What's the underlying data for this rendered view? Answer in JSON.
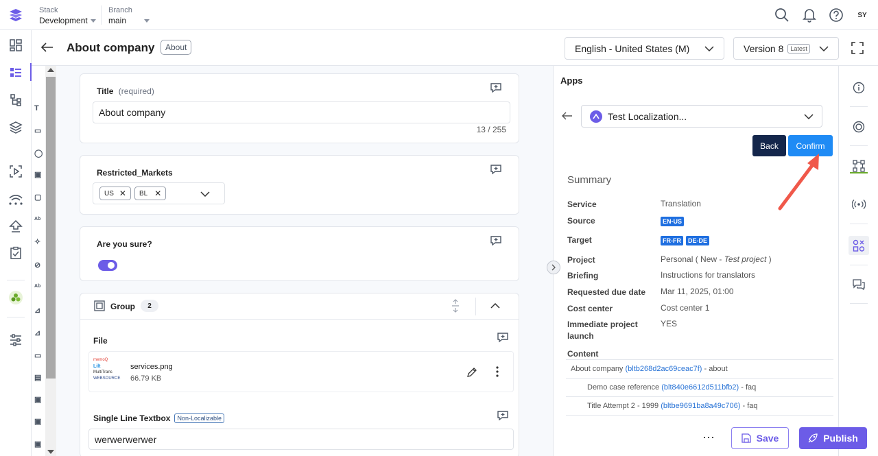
{
  "topbar": {
    "stack_label": "Stack",
    "stack_value": "Development",
    "branch_label": "Branch",
    "branch_value": "main",
    "avatar": "SY"
  },
  "header": {
    "title": "About company",
    "content_type_pill": "About",
    "locale": "English - United States (M)",
    "version": "Version 8",
    "version_badge": "Latest"
  },
  "left_rail_icons": [
    "dashboard-icon",
    "entries-icon",
    "content-models-icon",
    "assets-icon",
    "releases-icon",
    "workflows-icon",
    "deploy-icon",
    "tasks-icon",
    "apps-icon",
    "settings-icon"
  ],
  "field_strip": [
    "T",
    "▭",
    "◯",
    "▣",
    "▢",
    "Ab",
    "✧",
    "⊘",
    "Ab",
    "⊿",
    "⊿",
    "▭",
    "▤",
    "▣",
    "▣",
    "▣"
  ],
  "fields": {
    "title": {
      "label": "Title",
      "hint": "(required)",
      "value": "About company",
      "count": "13 / 255"
    },
    "restricted": {
      "label": "Restricted_Markets",
      "tags": [
        "US",
        "BL"
      ]
    },
    "sure": {
      "label": "Are you sure?",
      "toggle_on": true
    },
    "group": {
      "label": "Group",
      "count": "2",
      "file_label": "File",
      "file_name": "services.png",
      "file_size": "66.79 KB",
      "thumb_lines": [
        "memoQ",
        "Lilt",
        "MultiTrans",
        "WEBSOURCE"
      ],
      "textbox_label": "Single Line Textbox",
      "textbox_badge": "Non-Localizable",
      "textbox_value": "werwerwerwer"
    }
  },
  "apps_panel": {
    "title": "Apps",
    "app_select": "Test Localization...",
    "back_button": "Back",
    "confirm_button": "Confirm",
    "summary_title": "Summary",
    "rows": {
      "service": {
        "key": "Service",
        "value": "Translation"
      },
      "source": {
        "key": "Source",
        "tags": [
          "EN-US"
        ]
      },
      "target": {
        "key": "Target",
        "tags": [
          "FR-FR",
          "DE-DE"
        ]
      },
      "project": {
        "key": "Project",
        "value_a": "Personal ( New - ",
        "value_b": "Test project",
        "value_c": " )"
      },
      "briefing": {
        "key": "Briefing",
        "value": "Instructions for translators"
      },
      "due": {
        "key": "Requested due date",
        "value": "Mar 11, 2025, 01:00"
      },
      "cost": {
        "key": "Cost center",
        "value": "Cost center 1"
      },
      "launch": {
        "key": "Immediate project launch",
        "value": "YES"
      }
    },
    "content_label": "Content",
    "content": [
      {
        "title": "About company",
        "uid": "(bltb268d2ac69ceac7f)",
        "ct": " - about"
      },
      {
        "title": "Demo case reference",
        "uid": "(blt840e6612d511bfb2)",
        "ct": " - faq"
      },
      {
        "title": "Title Attempt 2 - 1999",
        "uid": "(bltbe9691ba8a49c706)",
        "ct": " - faq"
      }
    ]
  },
  "footer": {
    "more": "⋯",
    "save": "Save",
    "publish": "Publish"
  },
  "colors": {
    "accent": "#6c5ce7",
    "confirm": "#1f8bf5",
    "back": "#14264b",
    "arrow": "#f0584a",
    "link": "#2a74d6"
  }
}
